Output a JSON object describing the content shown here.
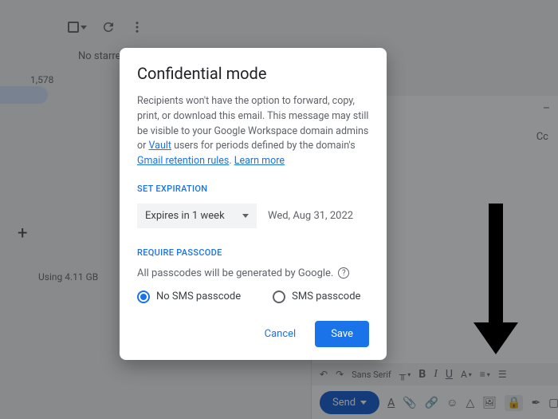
{
  "background": {
    "hint_text": "No starred                                                                                                                              nd. To star a message, click on the star outline besi",
    "sidebar_count": "1,578",
    "storage_text": "Using 4.11 GB"
  },
  "compose": {
    "cc_label": "Cc",
    "dash": "–",
    "send_label": "Send",
    "font_family": "Sans Serif"
  },
  "dialog": {
    "title": "Confidential mode",
    "desc_part1": "Recipients won't have the option to forward, copy, print, or download this email. This message may still be visible to your Google Workspace domain admins or ",
    "link_vault": "Vault",
    "desc_part2": " users for periods defined by the domain's ",
    "link_retention": "Gmail retention rules",
    "desc_part3": ". ",
    "link_learn": "Learn more",
    "expiration_label": "SET EXPIRATION",
    "expiry_value": "Expires in 1 week",
    "expiry_date": "Wed, Aug 31, 2022",
    "passcode_label": "REQUIRE PASSCODE",
    "passcode_note": "All passcodes will be generated by Google.",
    "radio_no_sms": "No SMS passcode",
    "radio_sms": "SMS passcode",
    "cancel": "Cancel",
    "save": "Save"
  }
}
